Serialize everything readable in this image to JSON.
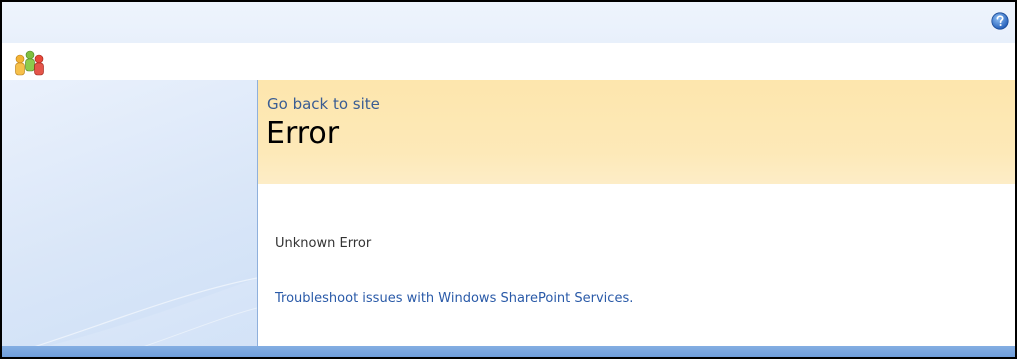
{
  "header": {
    "logo_icon": "people-group-icon",
    "help_icon": "help-icon"
  },
  "main": {
    "back_link": "Go back to site",
    "title": "Error",
    "message": "Unknown Error",
    "troubleshoot_link": "Troubleshoot issues with Windows SharePoint Services."
  },
  "colors": {
    "title_band": "#fde6ad",
    "nav_background": "#dae6f8",
    "link": "#2a5aa8",
    "bottom_bar": "#7aa7df"
  }
}
